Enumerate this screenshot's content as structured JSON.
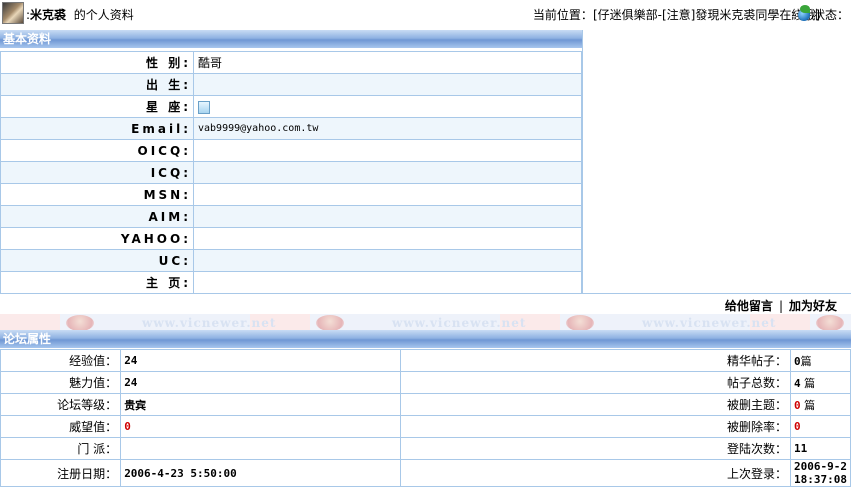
{
  "header": {
    "username": "米克裘",
    "profile_suffix": "的个人资料",
    "location_prefix": "当前位置：",
    "location_path": "[仔迷俱樂部-[注意]發現米克裘同學在綫哦]",
    "status_label": "状态："
  },
  "basic": {
    "section_title": "基本资料",
    "rows": [
      {
        "label": "性 别:",
        "value": "酷哥"
      },
      {
        "label": "出 生:",
        "value": ""
      },
      {
        "label": "星 座:",
        "value": ""
      },
      {
        "label": "Email:",
        "value": "vab9999@yahoo.com.tw"
      },
      {
        "label": "OICQ:",
        "value": ""
      },
      {
        "label": "ICQ:",
        "value": ""
      },
      {
        "label": "MSN:",
        "value": ""
      },
      {
        "label": "AIM:",
        "value": ""
      },
      {
        "label": "YAHOO:",
        "value": ""
      },
      {
        "label": "UC:",
        "value": ""
      },
      {
        "label": "主 页:",
        "value": ""
      }
    ],
    "leave_message": "给他留言",
    "separator": "|",
    "add_friend": "加为好友"
  },
  "watermark": "www.vicnewer.net",
  "forum": {
    "section_title": "论坛属性",
    "rows": [
      {
        "l1": "经验值：",
        "v1": "24",
        "l2": "精华帖子：",
        "v2": "0",
        "v2_suffix": "篇"
      },
      {
        "l1": "魅力值：",
        "v1": "24",
        "l2": "帖子总数：",
        "v2": "4",
        "v2_suffix": " 篇"
      },
      {
        "l1": "论坛等级：",
        "v1": "贵宾",
        "l2": "被删主题：",
        "v2": "0",
        "v2_suffix": " 篇"
      },
      {
        "l1": "威望值：",
        "v1": "0",
        "l2": "被删除率：",
        "v2": "0",
        "v2_suffix": ""
      },
      {
        "l1": "门 派：",
        "v1": "",
        "l2": "登陆次数：",
        "v2": "11",
        "v2_suffix": ""
      },
      {
        "l1": "注册日期：",
        "v1": "2006-4-23 5:50:00",
        "l2": "上次登录：",
        "v2": "2006-9-2 18:37:08",
        "v2_suffix": ""
      }
    ]
  },
  "colors": {
    "accent_red": "#d00000",
    "header_blue": "#7aa2d8",
    "border_blue": "#a8c8e8"
  }
}
